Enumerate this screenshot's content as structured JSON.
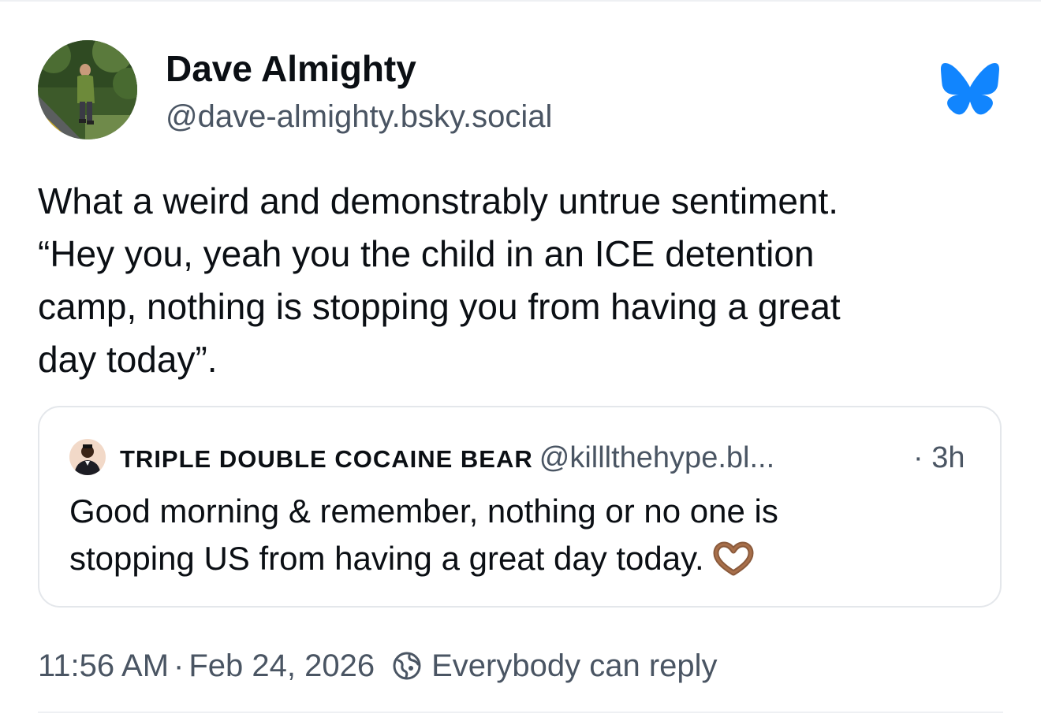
{
  "author": {
    "display_name": "Dave Almighty",
    "handle": "@dave-almighty.bsky.social",
    "avatar_icon": "user-avatar-photo"
  },
  "brand": {
    "logo_icon": "bluesky-butterfly-icon",
    "color": "#1185fe"
  },
  "post": {
    "lines": [
      "What a weird and demonstrably untrue sentiment.",
      "“Hey you, yeah you the child in an ICE detention",
      "camp, nothing is stopping you from having a great",
      "day today”."
    ]
  },
  "quoted_post": {
    "display_name": "TRIPLE DOUBLE COCAINE BEAR",
    "handle": "@killlthehype.bl...",
    "time": "· 3h",
    "lines": [
      "Good morning & remember, nothing or no one is",
      "stopping US from having a great day today."
    ],
    "emoji_icon": "heart-hands-icon"
  },
  "meta": {
    "time": "11:56 AM",
    "separator": "·",
    "date": "Feb 24, 2026",
    "reply_setting": "Everybody can reply",
    "reply_icon": "globe-icon"
  },
  "colors": {
    "text": "#0b0f14",
    "secondary": "#4a5563",
    "border": "#e4e7eb"
  }
}
